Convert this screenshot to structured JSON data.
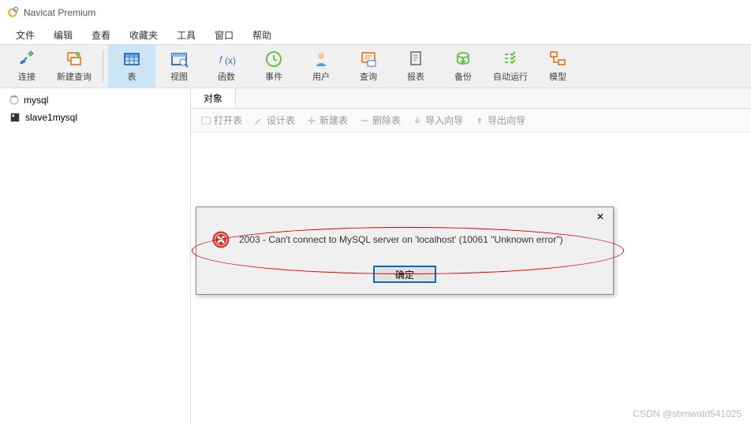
{
  "window": {
    "title": "Navicat Premium"
  },
  "menu": {
    "items": [
      "文件",
      "编辑",
      "查看",
      "收藏夹",
      "工具",
      "窗口",
      "帮助"
    ]
  },
  "toolbar": {
    "connect": "连接",
    "newquery": "新建查询",
    "table": "表",
    "view": "视图",
    "function": "函数",
    "event": "事件",
    "user": "用户",
    "query": "查询",
    "report": "报表",
    "backup": "备份",
    "automation": "自动运行",
    "model": "模型"
  },
  "sidebar": {
    "connections": [
      {
        "name": "mysql",
        "loading": true
      },
      {
        "name": "slave1mysql",
        "loading": false
      }
    ]
  },
  "content": {
    "tab": "对象",
    "subtoolbar": [
      "打开表",
      "设计表",
      "新建表",
      "删除表",
      "导入向导",
      "导出向导"
    ]
  },
  "dialog": {
    "message": "2003 - Can't connect to MySQL server on 'localhost' (10061 \"Unknown error\")",
    "ok": "确定"
  },
  "watermark": "CSDN @sbmwatd541025"
}
